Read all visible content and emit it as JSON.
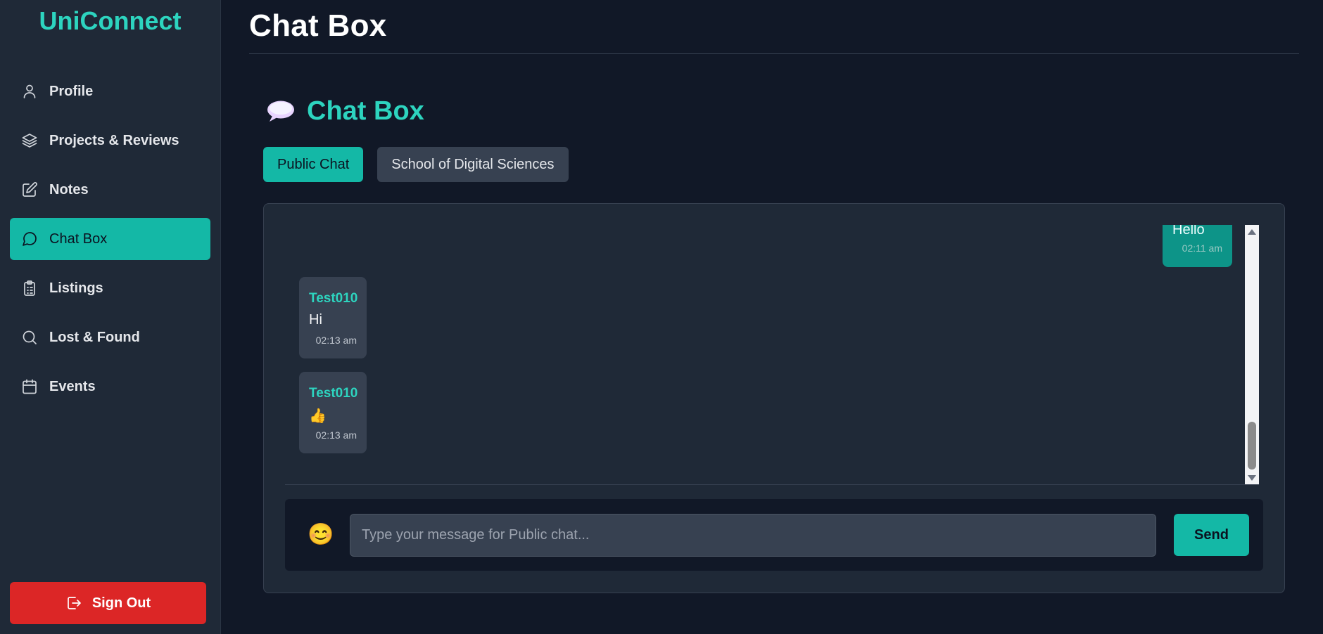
{
  "app": {
    "brand": "UniConnect",
    "accent": "#2dd4bf"
  },
  "sidebar": {
    "items": [
      {
        "label": "Profile",
        "icon": "user-icon",
        "active": false
      },
      {
        "label": "Projects & Reviews",
        "icon": "layers-icon",
        "active": false
      },
      {
        "label": "Notes",
        "icon": "edit-icon",
        "active": false
      },
      {
        "label": "Chat Box",
        "icon": "chat-bubble-icon",
        "active": true
      },
      {
        "label": "Listings",
        "icon": "clipboard-icon",
        "active": false
      },
      {
        "label": "Lost & Found",
        "icon": "search-icon",
        "active": false
      },
      {
        "label": "Events",
        "icon": "calendar-icon",
        "active": false
      }
    ],
    "signout_label": "Sign Out"
  },
  "page": {
    "title": "Chat Box"
  },
  "chat": {
    "panel_title": "Chat Box",
    "panel_icon": "speech-balloon-icon",
    "tabs": [
      {
        "label": "Public Chat",
        "active": true
      },
      {
        "label": "School of Digital Sciences",
        "active": false
      }
    ],
    "messages": [
      {
        "direction": "outgoing",
        "text": "Hello",
        "time": "02:11 am"
      },
      {
        "direction": "incoming",
        "user": "Test010",
        "text": "Hi",
        "time": "02:13 am"
      },
      {
        "direction": "incoming",
        "user": "Test010",
        "text": "👍",
        "time": "02:13 am"
      }
    ],
    "composer": {
      "emoji": "😊",
      "placeholder": "Type your message for Public chat...",
      "value": "",
      "send_label": "Send"
    }
  }
}
